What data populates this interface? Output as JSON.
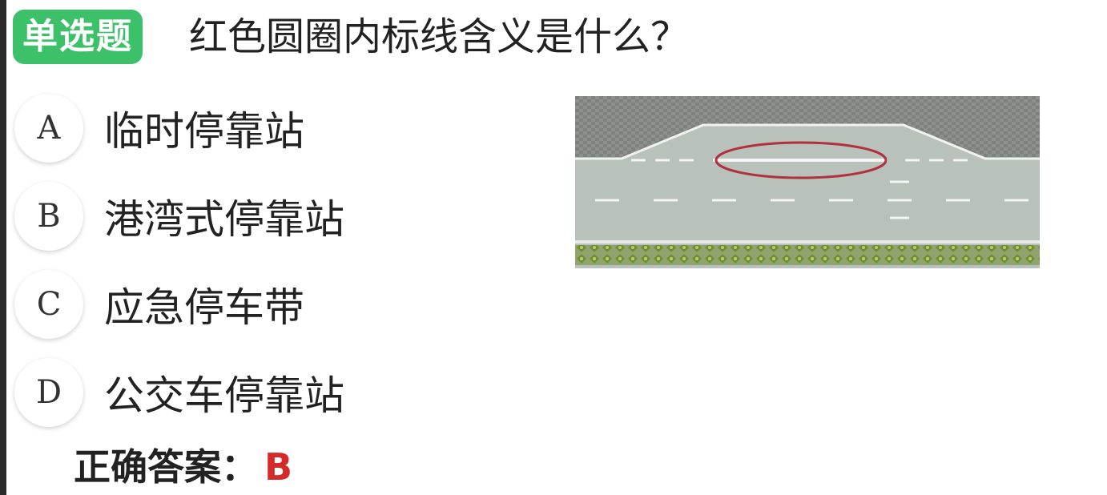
{
  "question": {
    "type_badge": "单选题",
    "text": "红色圆圈内标线含义是什么？"
  },
  "options": [
    {
      "letter": "A",
      "text": "临时停靠站"
    },
    {
      "letter": "B",
      "text": "港湾式停靠站"
    },
    {
      "letter": "C",
      "text": "应急停车带"
    },
    {
      "letter": "D",
      "text": "公交车停靠站"
    }
  ],
  "answer": {
    "label": "正确答案：",
    "value": "B"
  },
  "colors": {
    "badge": "#3cc06a",
    "answer_value": "#d42a2a",
    "circle_highlight": "#b0303f",
    "road": "#b9c1bb",
    "sidewalk": "#8d918e"
  }
}
